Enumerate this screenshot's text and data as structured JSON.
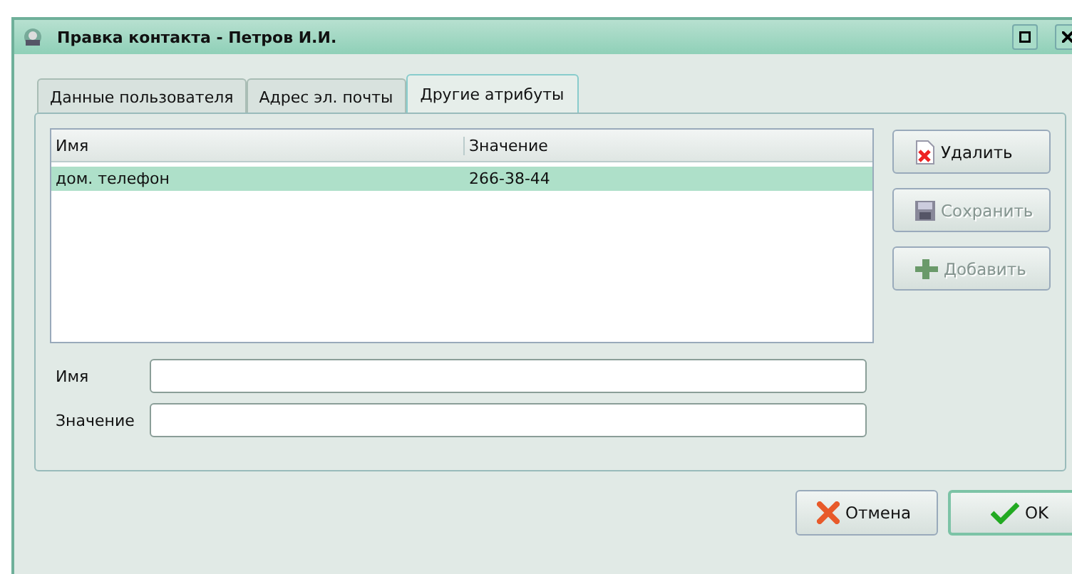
{
  "window": {
    "title": "Правка контакта - Петров И.И."
  },
  "tabs": [
    {
      "label": "Данные пользователя",
      "selected": false
    },
    {
      "label": "Адрес эл. почты",
      "selected": false
    },
    {
      "label": "Другие атрибуты",
      "selected": true
    }
  ],
  "table": {
    "columns": [
      "Имя",
      "Значение"
    ],
    "rows": [
      {
        "cells": [
          "дом. телефон",
          "266-38-44"
        ],
        "selected": true
      }
    ]
  },
  "side_buttons": [
    {
      "label": "Удалить",
      "kind": "delete",
      "disabled": false
    },
    {
      "label": "Сохранить",
      "kind": "save",
      "disabled": true
    },
    {
      "label": "Добавить",
      "kind": "add",
      "disabled": true
    }
  ],
  "fields": [
    {
      "label": "Имя"
    },
    {
      "label": "Значение"
    }
  ],
  "buttons": [
    {
      "label": "Отмена",
      "kind": "cancel"
    },
    {
      "label": "OK",
      "kind": "ok"
    }
  ]
}
